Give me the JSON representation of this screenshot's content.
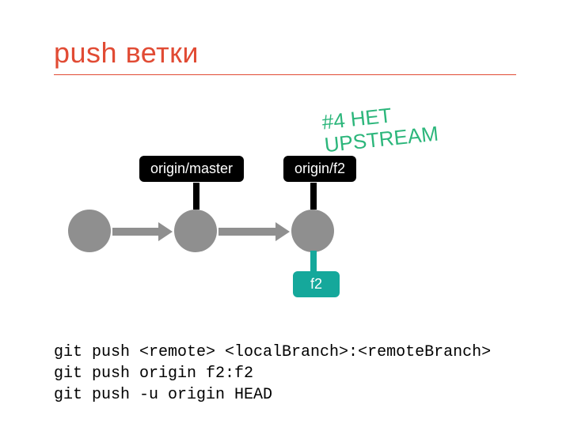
{
  "title": "push ветки",
  "annotation": "#4 НЕТ\nUPSTREAM",
  "labels": {
    "origin_master": "origin/master",
    "origin_f2": "origin/f2",
    "f2": "f2"
  },
  "code": {
    "line1": "git push <remote> <localBranch>:<remoteBranch>",
    "line2": "git push origin f2:f2",
    "line3": "git push -u origin HEAD"
  },
  "colors": {
    "accent": "#e14b34",
    "annotation": "#2cb67b",
    "commit": "#8f8f8f",
    "teal": "#15a89b",
    "black": "#000000"
  },
  "chart_data": {
    "type": "diagram",
    "description": "Git commit graph showing three commits in a line. Second commit is tagged origin/master. Third commit is tagged origin/f2 (above) and f2 (below, local branch). Annotation '#4 НЕТ UPSTREAM' points to the lack of upstream tracking.",
    "commits": [
      {
        "id": "c1",
        "refs": []
      },
      {
        "id": "c2",
        "refs": [
          "origin/master"
        ]
      },
      {
        "id": "c3",
        "refs": [
          "origin/f2",
          "f2"
        ]
      }
    ],
    "edges": [
      [
        "c1",
        "c2"
      ],
      [
        "c2",
        "c3"
      ]
    ]
  }
}
